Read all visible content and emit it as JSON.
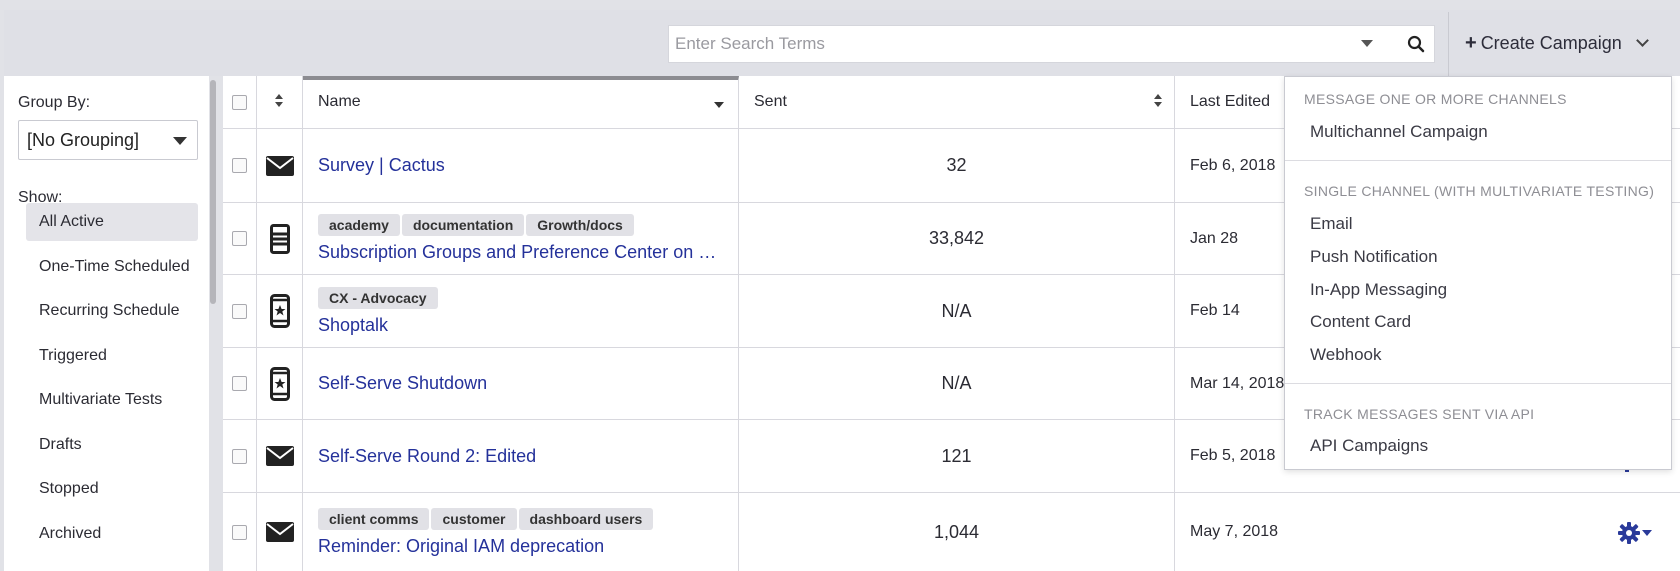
{
  "search": {
    "placeholder": "Enter Search Terms"
  },
  "create_button": {
    "label": "Create Campaign"
  },
  "sidebar": {
    "group_by_label": "Group By:",
    "group_by_value": "[No Grouping]",
    "show_label": "Show:",
    "filters": [
      {
        "label": "All Active",
        "active": true
      },
      {
        "label": "One-Time Scheduled",
        "active": false
      },
      {
        "label": "Recurring Schedule",
        "active": false
      },
      {
        "label": "Triggered",
        "active": false
      },
      {
        "label": "Multivariate Tests",
        "active": false
      },
      {
        "label": "Drafts",
        "active": false
      },
      {
        "label": "Stopped",
        "active": false
      },
      {
        "label": "Archived",
        "active": false
      }
    ]
  },
  "table": {
    "headers": {
      "name": "Name",
      "sent": "Sent",
      "last_edited": "Last Edited"
    },
    "rows": [
      {
        "icon": "email-icon",
        "tags": [],
        "name": "Survey | Cactus",
        "sent": "32",
        "last_edited": "Feb 6, 2018"
      },
      {
        "icon": "content-card-icon",
        "tags": [
          "academy",
          "documentation",
          "Growth/docs"
        ],
        "name": "Subscription Groups and Preference Center on Dashboard",
        "sent": "33,842",
        "last_edited": "Jan 28"
      },
      {
        "icon": "in-app-message-icon",
        "tags": [
          "CX - Advocacy"
        ],
        "name": "Shoptalk",
        "sent": "N/A",
        "last_edited": "Feb 14"
      },
      {
        "icon": "in-app-message-icon",
        "tags": [],
        "name": "Self-Serve Shutdown",
        "sent": "N/A",
        "last_edited": "Mar 14, 2018"
      },
      {
        "icon": "email-icon",
        "tags": [],
        "name": "Self-Serve Round 2: Edited",
        "sent": "121",
        "last_edited": "Feb 5, 2018"
      },
      {
        "icon": "email-icon",
        "tags": [
          "client comms",
          "customer",
          "dashboard users"
        ],
        "name": "Reminder: Original IAM deprecation",
        "sent": "1,044",
        "last_edited": "May 7, 2018"
      }
    ]
  },
  "dropdown": {
    "section1_heading": "MESSAGE ONE OR MORE CHANNELS",
    "section1_items": [
      "Multichannel Campaign"
    ],
    "section2_heading": "SINGLE CHANNEL (WITH MULTIVARIATE TESTING)",
    "section2_items": [
      "Email",
      "Push Notification",
      "In-App Messaging",
      "Content Card",
      "Webhook"
    ],
    "section3_heading": "TRACK MESSAGES SENT VIA API",
    "section3_items": [
      "API Campaigns"
    ]
  },
  "colors": {
    "link": "#24319a",
    "gear": "#2a3a9a"
  }
}
